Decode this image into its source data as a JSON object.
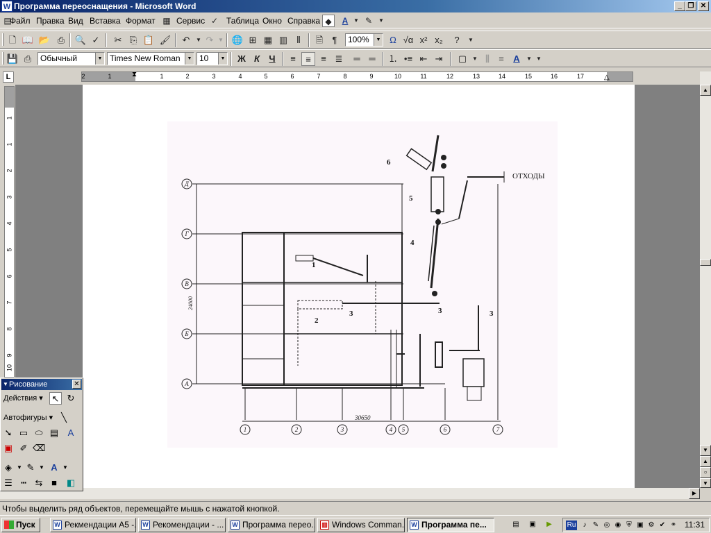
{
  "window": {
    "title": "Программа переоснащения - Microsoft Word",
    "minimize": "_",
    "restore": "❐",
    "close": "✕"
  },
  "menu": {
    "items": [
      "Файл",
      "Правка",
      "Вид",
      "Вставка",
      "Формат",
      "Сервис",
      "Таблица",
      "Окно",
      "Справка"
    ]
  },
  "toolbar_standard": {
    "zoom": "100%"
  },
  "toolbar_format": {
    "style": "Обычный",
    "font": "Times New Roman",
    "size": "10",
    "bold": "Ж",
    "italic": "К",
    "underline": "Ч"
  },
  "ruler": {
    "h_numbers": [
      "2",
      "1",
      "1",
      "2",
      "3",
      "4",
      "5",
      "6",
      "7",
      "8",
      "9",
      "10",
      "11",
      "12",
      "13",
      "14",
      "15",
      "16",
      "17"
    ],
    "v_numbers": [
      "1",
      "1",
      "2",
      "3",
      "4",
      "5",
      "6",
      "7",
      "8",
      "9",
      "10"
    ]
  },
  "drawing": {
    "labels": {
      "waste": "ОТХОДЫ",
      "l1": "1",
      "l2": "2",
      "l3a": "3",
      "l3b": "3",
      "l3c": "3",
      "l4": "4",
      "l5": "5",
      "l6": "6",
      "dim_v": "24000",
      "dim_h": "30650"
    },
    "row_axes": [
      "Д",
      "Г",
      "В",
      "Б",
      "А"
    ],
    "col_axes": [
      "1",
      "2",
      "3",
      "4",
      "5",
      "6",
      "7"
    ]
  },
  "drawing_panel": {
    "title": "Рисование",
    "actions": "Действия",
    "autoshapes": "Автофигуры"
  },
  "statusbar": {
    "text": "Чтобы выделить ряд объектов, перемещайте мышь с нажатой кнопкой."
  },
  "taskbar": {
    "start": "Пуск",
    "tasks": [
      "Рекмендации А5 -...",
      "Рекомендации - ...",
      "Программа перео...",
      "Windows Comman...",
      "Программа пе..."
    ],
    "active_index": 4,
    "lang": "Ru",
    "clock": "11:31"
  }
}
